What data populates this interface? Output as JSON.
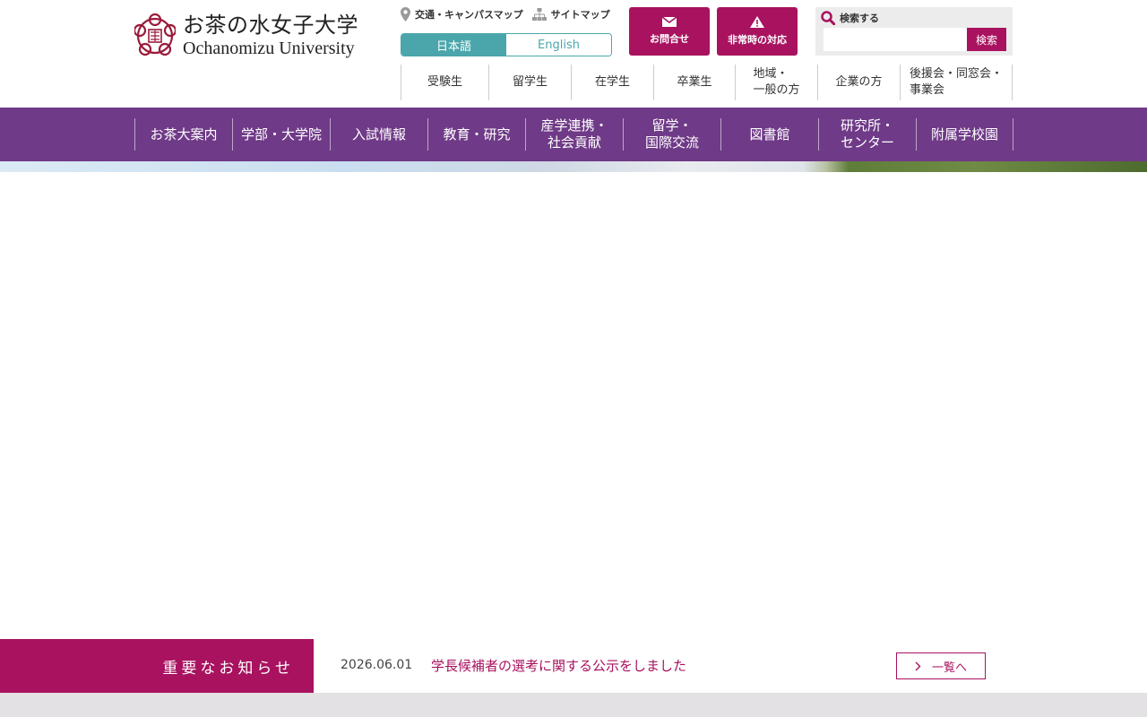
{
  "logo": {
    "jp": "お茶の水女子大学",
    "en": "Ochanomizu University"
  },
  "util_links": [
    {
      "label": "交通・キャンパスマップ",
      "icon": "map-pin-icon"
    },
    {
      "label": "サイトマップ",
      "icon": "sitemap-icon"
    }
  ],
  "lang": {
    "ja": "日本語",
    "en": "English"
  },
  "buttons": {
    "contact": "お問合せ",
    "emergency": "非常時の対応"
  },
  "search": {
    "label": "検索する",
    "button": "検索",
    "value": ""
  },
  "audience": [
    {
      "label": "受験生"
    },
    {
      "label": "留学生"
    },
    {
      "label": "在学生"
    },
    {
      "label": "卒業生"
    },
    {
      "label": "地域・\n一般の方"
    },
    {
      "label": "企業の方"
    },
    {
      "label": "後援会・同窓会・\n事業会"
    }
  ],
  "gnav": [
    {
      "label": "お茶大案内"
    },
    {
      "label": "学部・大学院"
    },
    {
      "label": "入試情報"
    },
    {
      "label": "教育・研究"
    },
    {
      "label": "産学連携・\n社会貢献"
    },
    {
      "label": "留学・\n国際交流"
    },
    {
      "label": "図書館"
    },
    {
      "label": "研究所・\nセンター"
    },
    {
      "label": "附属学校園"
    }
  ],
  "notice": {
    "title": "重要なお知らせ",
    "date": "2026.06.01",
    "message": "学長候補者の選考に関する公示をしました",
    "list_button": "一覧へ"
  },
  "colors": {
    "accent": "#a8125f",
    "nav": "#6f3a87",
    "teal": "#4aa6ab"
  }
}
